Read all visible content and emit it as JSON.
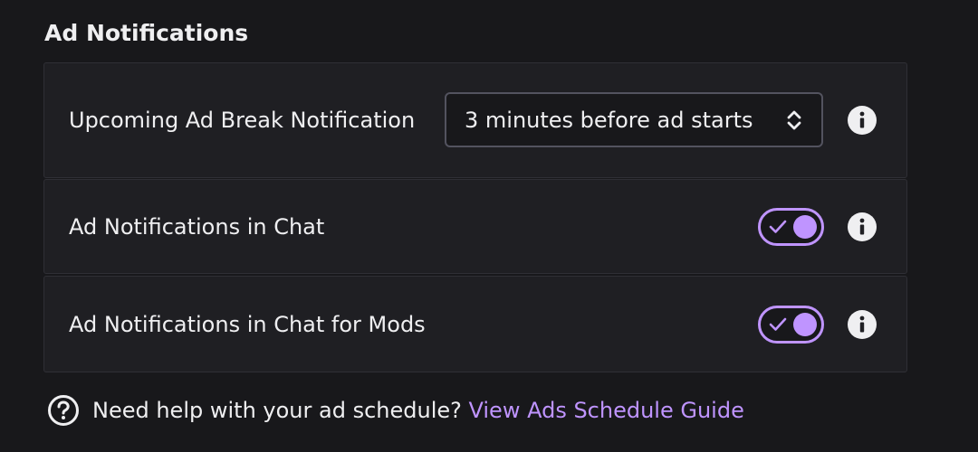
{
  "section": {
    "title": "Ad Notifications"
  },
  "rows": [
    {
      "label": "Upcoming Ad Break Notification",
      "control": "select",
      "select_value": "3 minutes before ad starts",
      "info_icon": "info-icon"
    },
    {
      "label": "Ad Notifications in Chat",
      "control": "toggle",
      "toggle_on": true,
      "info_icon": "info-icon"
    },
    {
      "label": "Ad Notifications in Chat for Mods",
      "control": "toggle",
      "toggle_on": true,
      "info_icon": "info-icon"
    }
  ],
  "help": {
    "icon": "question-circle-icon",
    "text": "Need help with your ad schedule?",
    "link_text": "View Ads Schedule Guide"
  },
  "colors": {
    "background": "#18181b",
    "panel": "#1f1f23",
    "accent": "#bf94ff",
    "text": "#efeff1"
  }
}
